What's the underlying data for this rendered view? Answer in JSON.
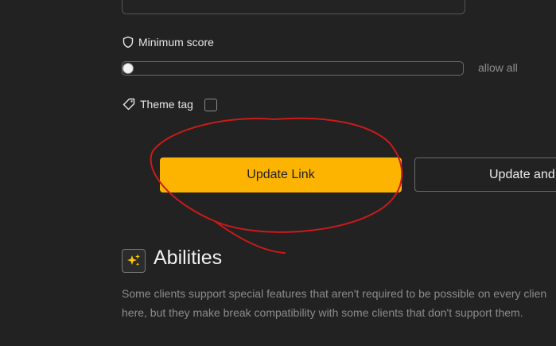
{
  "form": {
    "minimum_score": {
      "label": "Minimum score",
      "icon": "shield-icon",
      "value_text": "allow all",
      "level": 0
    },
    "theme_tag": {
      "label": "Theme tag",
      "icon": "tag-icon",
      "checked": false
    },
    "buttons": {
      "update_link": "Update Link",
      "update_and": "Update and"
    },
    "primary_color": "#fdb400",
    "annotation_color": "#cc1a1a"
  },
  "abilities": {
    "icon": "sparkles-icon",
    "title": "Abilities",
    "description_line1": "Some clients support special features that aren't required to be possible on every clien",
    "description_line2": "here, but they make break compatibility with some clients that don't support them."
  }
}
